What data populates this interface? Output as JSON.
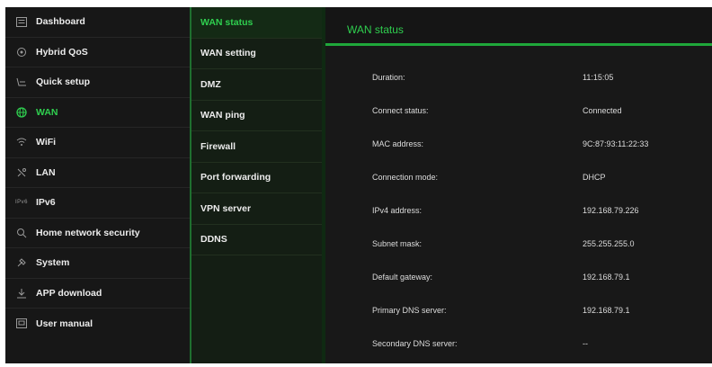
{
  "colors": {
    "accent": "#2fcf4f",
    "background": "#141414"
  },
  "nav": {
    "items": [
      {
        "label": "Dashboard",
        "icon": "dashboard-icon",
        "active": false
      },
      {
        "label": "Hybrid QoS",
        "icon": "qos-icon",
        "active": false
      },
      {
        "label": "Quick setup",
        "icon": "quick-setup-icon",
        "active": false
      },
      {
        "label": "WAN",
        "icon": "globe-icon",
        "active": true
      },
      {
        "label": "WiFi",
        "icon": "wifi-icon",
        "active": false
      },
      {
        "label": "LAN",
        "icon": "lan-icon",
        "active": false
      },
      {
        "label": "IPv6",
        "icon": "ipv6-icon",
        "active": false
      },
      {
        "label": "Home network security",
        "icon": "security-icon",
        "active": false
      },
      {
        "label": "System",
        "icon": "system-icon",
        "active": false
      },
      {
        "label": "APP download",
        "icon": "download-icon",
        "active": false
      },
      {
        "label": "User manual",
        "icon": "manual-icon",
        "active": false
      }
    ]
  },
  "subnav": {
    "items": [
      {
        "label": "WAN status",
        "active": true
      },
      {
        "label": "WAN setting",
        "active": false
      },
      {
        "label": "DMZ",
        "active": false
      },
      {
        "label": "WAN ping",
        "active": false
      },
      {
        "label": "Firewall",
        "active": false
      },
      {
        "label": "Port forwarding",
        "active": false
      },
      {
        "label": "VPN server",
        "active": false
      },
      {
        "label": "DDNS",
        "active": false
      }
    ]
  },
  "main": {
    "title": "WAN status",
    "rows": [
      {
        "label": "Duration:",
        "value": "11:15:05"
      },
      {
        "label": "Connect status:",
        "value": "Connected"
      },
      {
        "label": "MAC address:",
        "value": "9C:87:93:11:22:33"
      },
      {
        "label": "Connection mode:",
        "value": "DHCP"
      },
      {
        "label": "IPv4 address:",
        "value": "192.168.79.226"
      },
      {
        "label": "Subnet mask:",
        "value": "255.255.255.0"
      },
      {
        "label": "Default gateway:",
        "value": "192.168.79.1"
      },
      {
        "label": "Primary DNS server:",
        "value": "192.168.79.1"
      },
      {
        "label": "Secondary DNS server:",
        "value": "--"
      }
    ]
  }
}
